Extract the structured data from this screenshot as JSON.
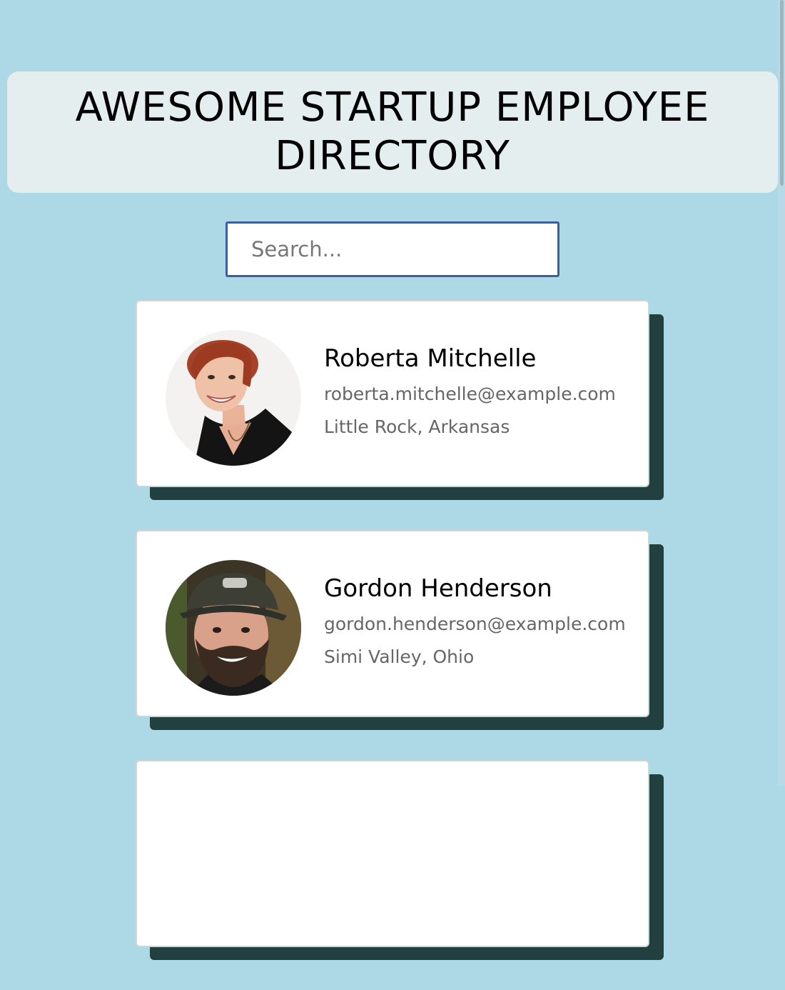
{
  "header": {
    "title": "AWESOME STARTUP EMPLOYEE DIRECTORY"
  },
  "search": {
    "placeholder": "Search...",
    "value": ""
  },
  "employees": [
    {
      "name": "Roberta Mitchelle",
      "email": "roberta.mitchelle@example.com",
      "location": "Little Rock, Arkansas",
      "photo": "woman-portrait"
    },
    {
      "name": "Gordon Henderson",
      "email": "gordon.henderson@example.com",
      "location": "Simi Valley, Ohio",
      "photo": "man-portrait"
    },
    {
      "name": "",
      "email": "",
      "location": "",
      "photo": ""
    }
  ],
  "colors": {
    "page_background": "#add8e6",
    "header_background": "#e4eeee",
    "card_shadow": "#22403f",
    "search_border": "#3a5f9c"
  }
}
